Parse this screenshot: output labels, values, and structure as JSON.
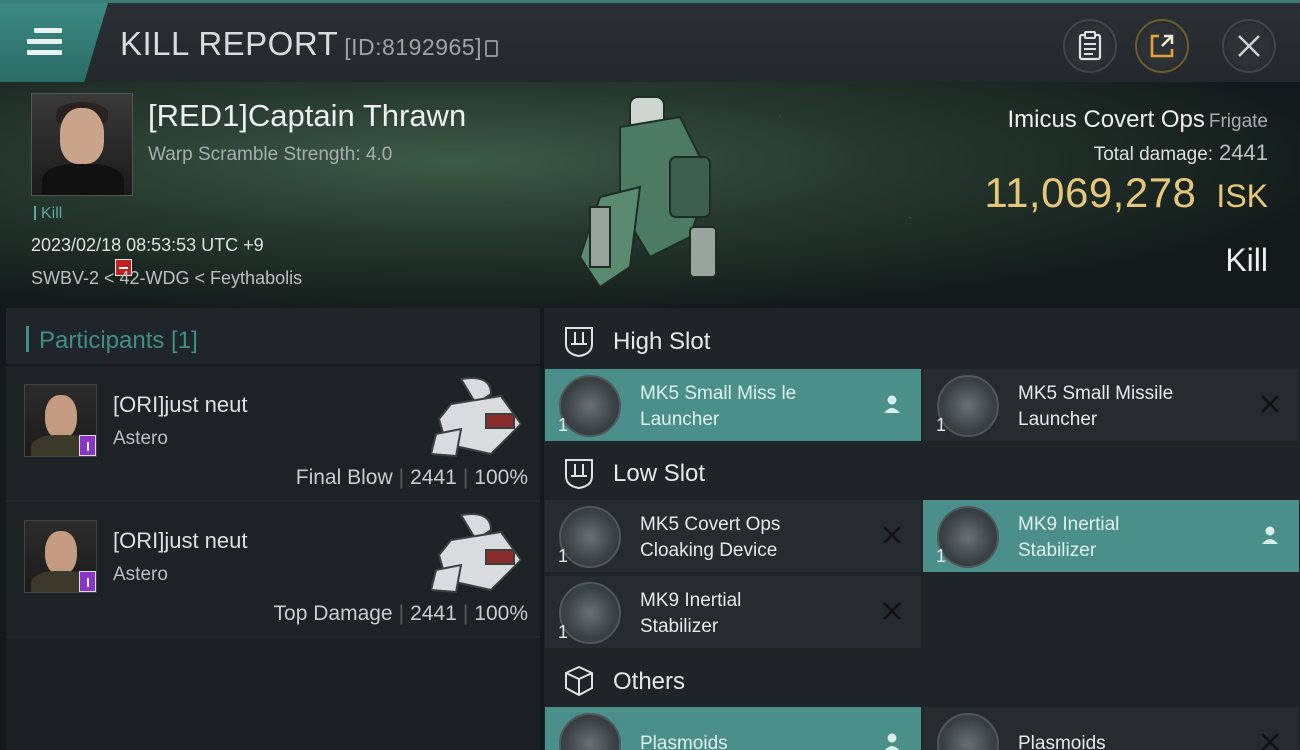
{
  "header": {
    "title": "KILL REPORT",
    "report_id": "[ID:8192965]"
  },
  "victim": {
    "name": "[RED1]Captain Thrawn",
    "subtitle": "Warp Scramble Strength: 4.0",
    "tag": "Kill",
    "datetime": "2023/02/18 08:53:53 UTC +9",
    "location": "SWBV-2 < 42-WDG < Feythabolis",
    "ship_name": "Imicus Covert Ops",
    "ship_class": "Frigate",
    "total_damage_label": "Total damage:",
    "total_damage": "2441",
    "isk_value": "11,069,278",
    "isk_unit": "ISK",
    "result": "Kill"
  },
  "participants": {
    "header": "Participants [1]",
    "rows": [
      {
        "name": "[ORI]just neut",
        "ship": "Astero",
        "role": "Final Blow",
        "damage": "2441",
        "percent": "100%"
      },
      {
        "name": "[ORI]just neut",
        "ship": "Astero",
        "role": "Top Damage",
        "damage": "2441",
        "percent": "100%"
      }
    ]
  },
  "fitting": {
    "high_slot": {
      "label": "High Slot",
      "items": [
        {
          "qty": "1",
          "line1": "MK5 Small Miss le",
          "line2": "Launcher",
          "status": "person-icon"
        },
        {
          "qty": "1",
          "line1": "MK5 Small Missile",
          "line2": "Launcher",
          "status": "close-icon"
        }
      ]
    },
    "low_slot": {
      "label": "Low Slot",
      "items": [
        {
          "qty": "1",
          "line1": "MK5 Covert Ops",
          "line2": "Cloaking Device",
          "status": "close-icon"
        },
        {
          "qty": "1",
          "line1": "MK9 Inertial",
          "line2": "Stabilizer",
          "status": "person-icon"
        },
        {
          "qty": "1",
          "line1": "MK9 Inertial",
          "line2": "Stabilizer",
          "status": "close-icon"
        }
      ]
    },
    "others": {
      "label": "Others",
      "items": [
        {
          "line1": "Plasmoids",
          "status": "person-icon"
        },
        {
          "line1": "Plasmoids",
          "status": "close-icon"
        }
      ]
    }
  },
  "colors": {
    "accent_teal": "#3f8f89",
    "isk_gold": "#e5c77a",
    "danger_red": "#c0211f",
    "badge_purple": "#8a35c9"
  }
}
